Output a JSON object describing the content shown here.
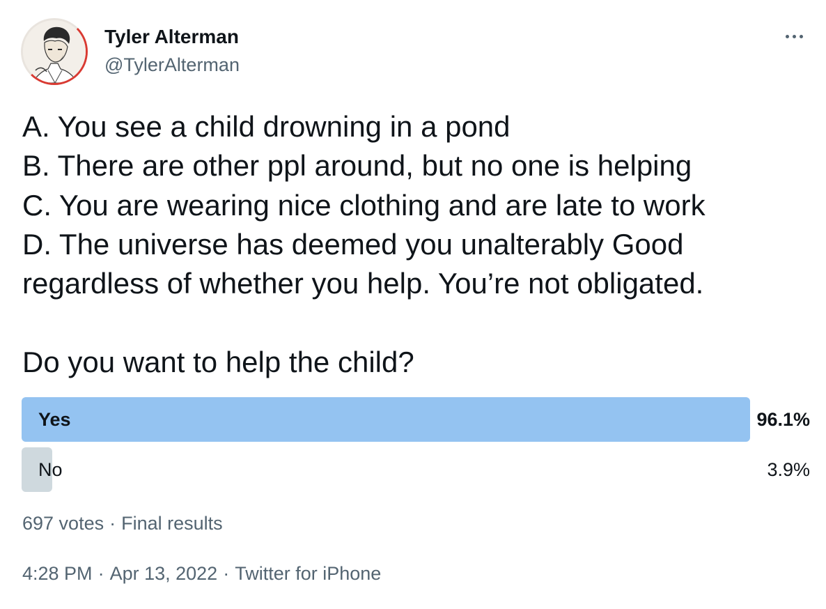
{
  "author": {
    "name": "Tyler Alterman",
    "handle": "@TylerAlterman",
    "avatar_icon": "sketch-portrait-avatar"
  },
  "menu": {
    "more_icon": "more-horizontal-icon"
  },
  "tweet": {
    "lines": [
      "A. You see a child drowning in a pond",
      "B. There are other ppl around, but no one is helping",
      "C. You are wearing nice clothing and are late to work",
      "D. The universe has deemed you unalterably Good",
      "regardless of whether you help. You’re not obligated."
    ],
    "question": "Do you want to help the child?"
  },
  "poll": {
    "options": [
      {
        "label": "Yes",
        "percent_text": "96.1%",
        "fraction": 0.961,
        "winner": true,
        "bar_color": "#94c3f1"
      },
      {
        "label": "No",
        "percent_text": "3.9%",
        "fraction": 0.039,
        "winner": false,
        "bar_color": "#cfd9de"
      }
    ],
    "votes": "697 votes",
    "status": "Final results"
  },
  "meta": {
    "time": "4:28 PM",
    "date": "Apr 13, 2022",
    "source": "Twitter for iPhone"
  },
  "colors": {
    "text_primary": "#0f1419",
    "text_secondary": "#536471",
    "winner_bar": "#94c3f1",
    "loser_bar": "#cfd9de",
    "avatar_ring": "#d93a32"
  }
}
